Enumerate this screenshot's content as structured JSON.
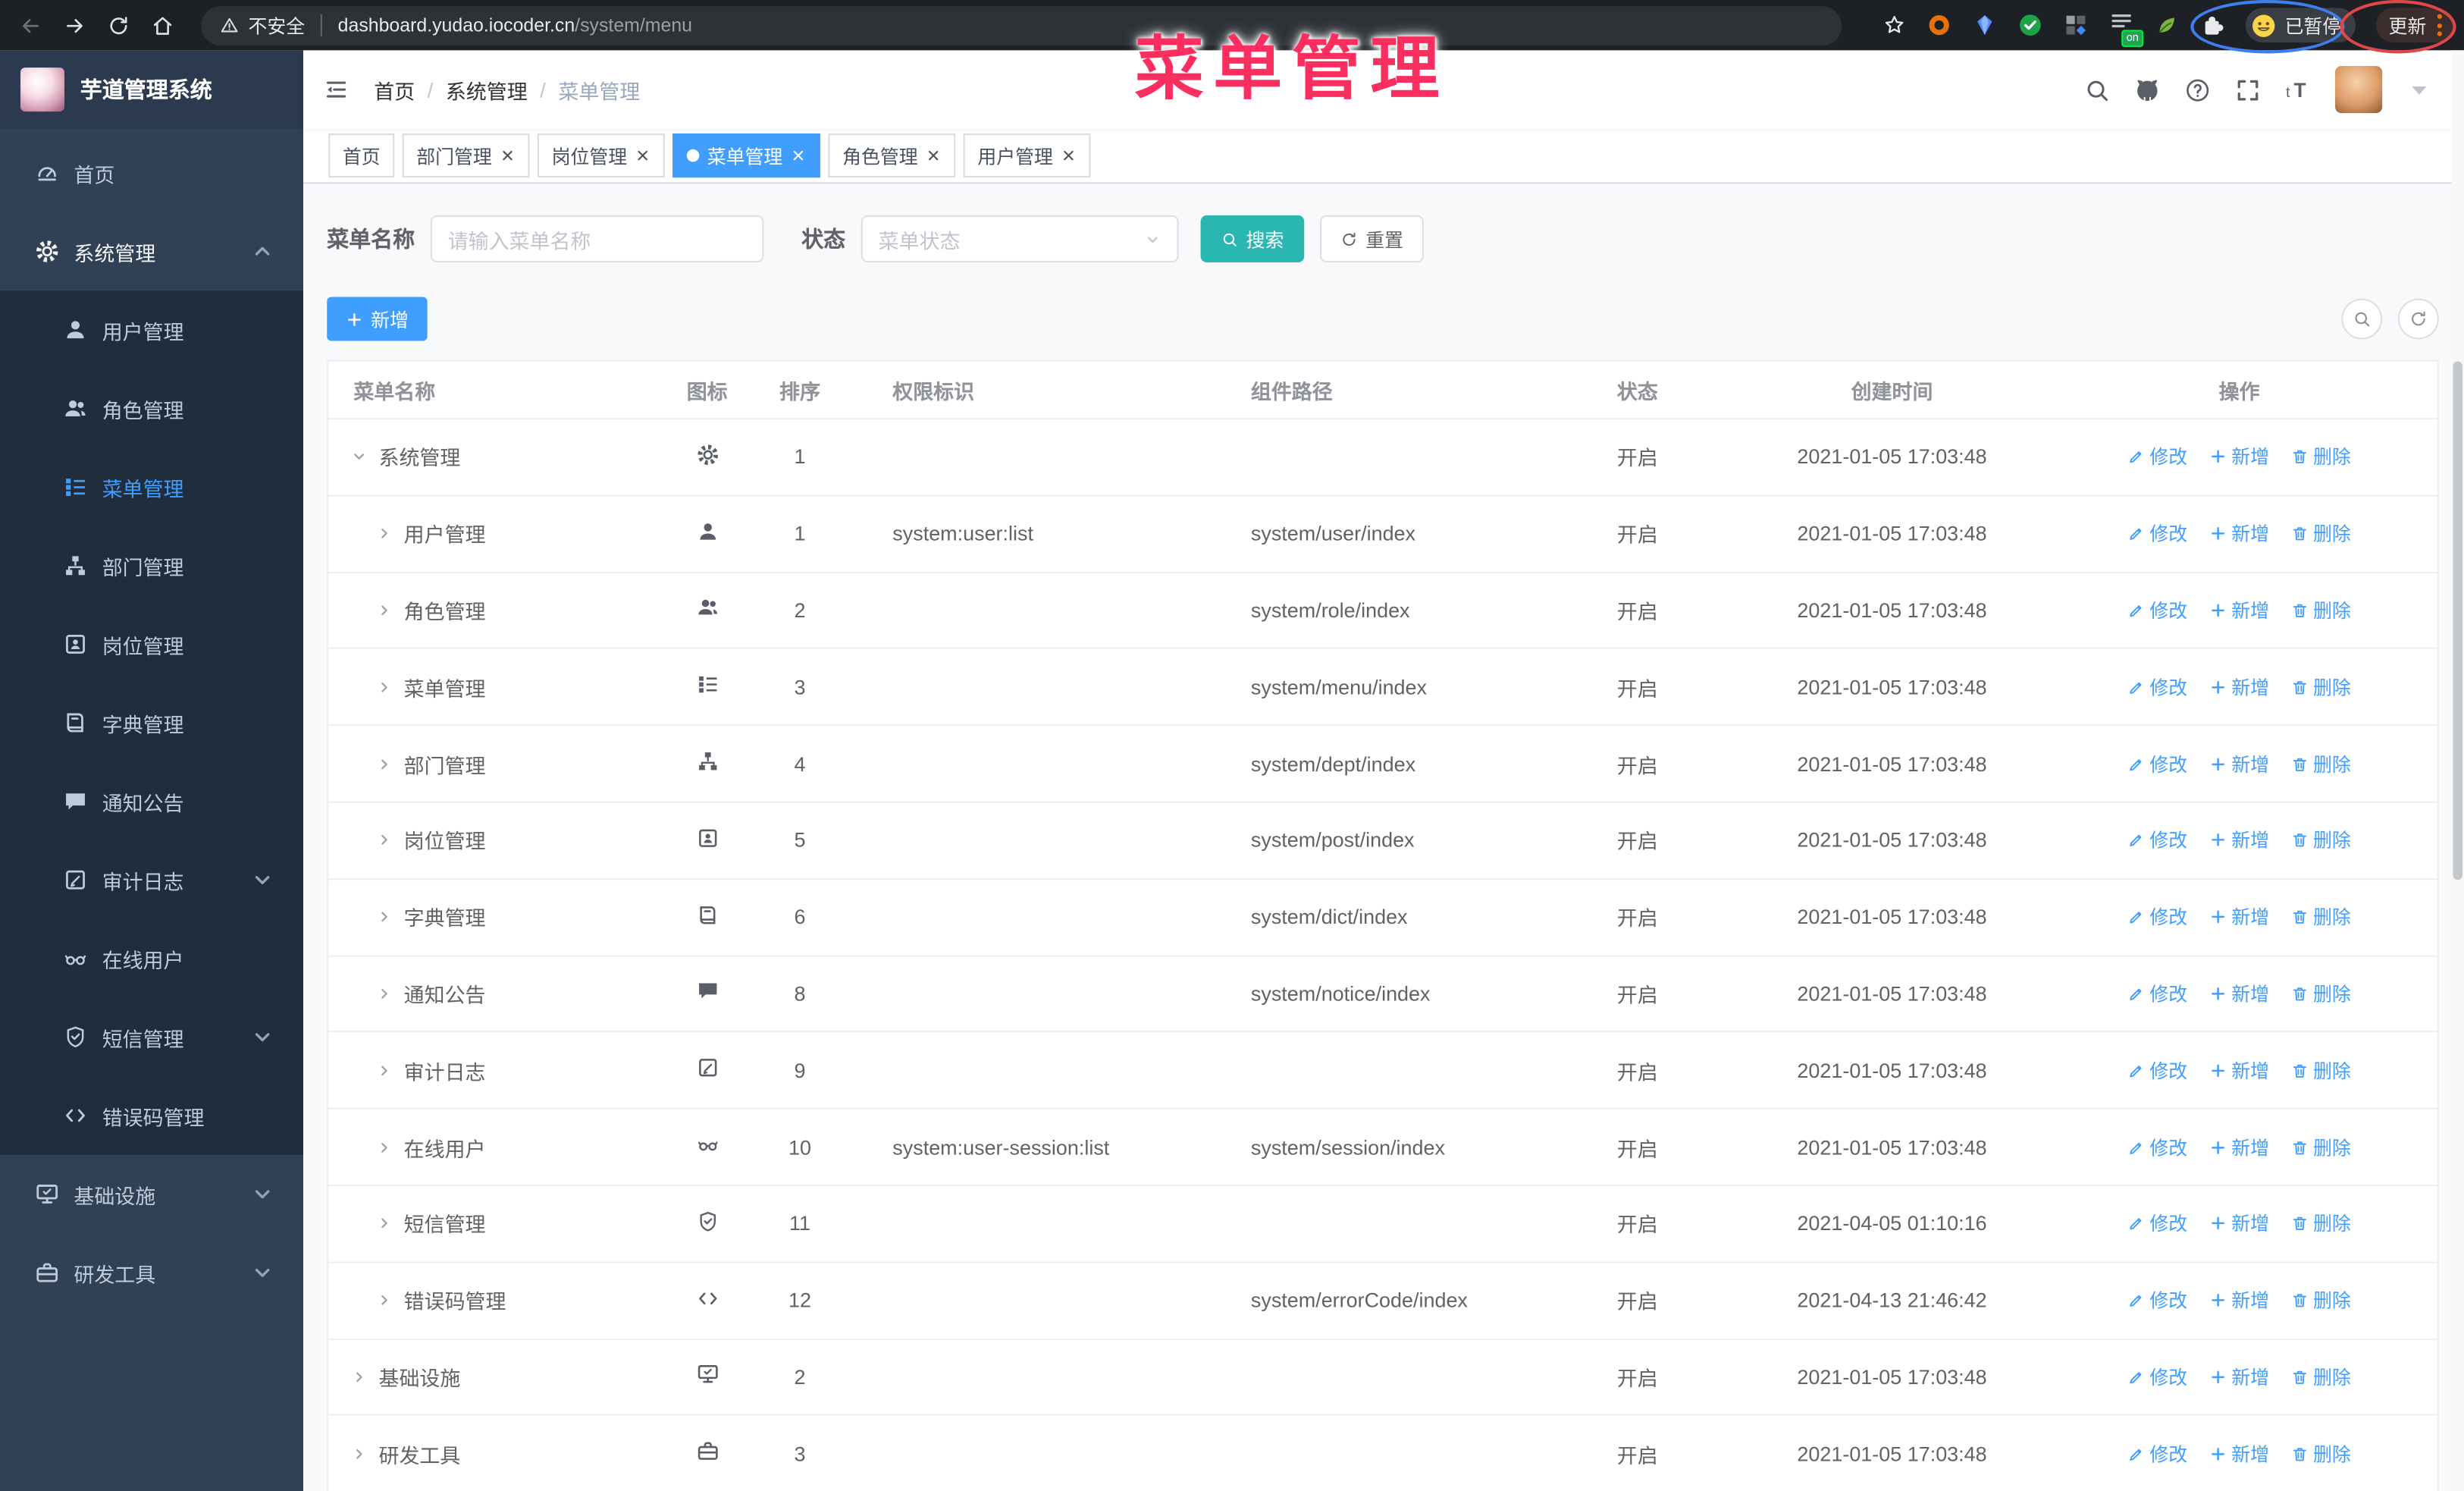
{
  "browser": {
    "security_label": "不安全",
    "url_host": "dashboard.yudao.iocoder.cn",
    "url_path": "/system/menu",
    "paused_badge": "已暂停",
    "update_button": "更新",
    "on_badge": "on"
  },
  "overlay_title": "菜单管理",
  "header": {
    "breadcrumb": [
      "首页",
      "系统管理",
      "菜单管理"
    ],
    "separator": "/"
  },
  "sidebar": {
    "app_title": "芋道管理系统",
    "items": [
      {
        "label": "首页",
        "icon": "dashboard-icon",
        "level": 1
      },
      {
        "label": "系统管理",
        "icon": "gear-icon",
        "level": 1,
        "expanded": true,
        "arrow": "up"
      },
      {
        "label": "用户管理",
        "icon": "user-icon",
        "level": 2
      },
      {
        "label": "角色管理",
        "icon": "peoples-icon",
        "level": 2
      },
      {
        "label": "菜单管理",
        "icon": "tree-table-icon",
        "level": 2,
        "active": true
      },
      {
        "label": "部门管理",
        "icon": "tree-icon",
        "level": 2
      },
      {
        "label": "岗位管理",
        "icon": "post-icon",
        "level": 2
      },
      {
        "label": "字典管理",
        "icon": "dict-icon",
        "level": 2
      },
      {
        "label": "通知公告",
        "icon": "message-icon",
        "level": 2
      },
      {
        "label": "审计日志",
        "icon": "log-icon",
        "level": 2,
        "arrow": "down"
      },
      {
        "label": "在线用户",
        "icon": "online-icon",
        "level": 2
      },
      {
        "label": "短信管理",
        "icon": "sms-icon",
        "level": 2,
        "arrow": "down"
      },
      {
        "label": "错误码管理",
        "icon": "code-icon",
        "level": 2
      },
      {
        "label": "基础设施",
        "icon": "monitor-icon",
        "level": 1,
        "arrow": "down"
      },
      {
        "label": "研发工具",
        "icon": "tool-icon",
        "level": 1,
        "arrow": "down"
      }
    ]
  },
  "tabs": [
    {
      "label": "首页",
      "closable": false,
      "active": false
    },
    {
      "label": "部门管理",
      "closable": true,
      "active": false
    },
    {
      "label": "岗位管理",
      "closable": true,
      "active": false
    },
    {
      "label": "菜单管理",
      "closable": true,
      "active": true
    },
    {
      "label": "角色管理",
      "closable": true,
      "active": false
    },
    {
      "label": "用户管理",
      "closable": true,
      "active": false
    }
  ],
  "filters": {
    "name_label": "菜单名称",
    "name_placeholder": "请输入菜单名称",
    "status_label": "状态",
    "status_placeholder": "菜单状态",
    "search_label": "搜索",
    "reset_label": "重置"
  },
  "toolbar": {
    "add_label": "新增"
  },
  "table": {
    "columns": [
      "菜单名称",
      "图标",
      "排序",
      "权限标识",
      "组件路径",
      "状态",
      "创建时间",
      "操作"
    ],
    "actions": {
      "edit": "修改",
      "add": "新增",
      "delete": "删除"
    },
    "rows": [
      {
        "name": "系统管理",
        "icon": "gear-icon",
        "level": 1,
        "expanded": true,
        "sort": "1",
        "perm": "",
        "path": "",
        "status": "开启",
        "time": "2021-01-05 17:03:48"
      },
      {
        "name": "用户管理",
        "icon": "user-icon",
        "level": 2,
        "expanded": false,
        "sort": "1",
        "perm": "system:user:list",
        "path": "system/user/index",
        "status": "开启",
        "time": "2021-01-05 17:03:48"
      },
      {
        "name": "角色管理",
        "icon": "peoples-icon",
        "level": 2,
        "expanded": false,
        "sort": "2",
        "perm": "",
        "path": "system/role/index",
        "status": "开启",
        "time": "2021-01-05 17:03:48"
      },
      {
        "name": "菜单管理",
        "icon": "tree-table-icon",
        "level": 2,
        "expanded": false,
        "sort": "3",
        "perm": "",
        "path": "system/menu/index",
        "status": "开启",
        "time": "2021-01-05 17:03:48"
      },
      {
        "name": "部门管理",
        "icon": "tree-icon",
        "level": 2,
        "expanded": false,
        "sort": "4",
        "perm": "",
        "path": "system/dept/index",
        "status": "开启",
        "time": "2021-01-05 17:03:48"
      },
      {
        "name": "岗位管理",
        "icon": "post-icon",
        "level": 2,
        "expanded": false,
        "sort": "5",
        "perm": "",
        "path": "system/post/index",
        "status": "开启",
        "time": "2021-01-05 17:03:48"
      },
      {
        "name": "字典管理",
        "icon": "dict-icon",
        "level": 2,
        "expanded": false,
        "sort": "6",
        "perm": "",
        "path": "system/dict/index",
        "status": "开启",
        "time": "2021-01-05 17:03:48"
      },
      {
        "name": "通知公告",
        "icon": "message-icon",
        "level": 2,
        "expanded": false,
        "sort": "8",
        "perm": "",
        "path": "system/notice/index",
        "status": "开启",
        "time": "2021-01-05 17:03:48"
      },
      {
        "name": "审计日志",
        "icon": "log-icon",
        "level": 2,
        "expanded": false,
        "sort": "9",
        "perm": "",
        "path": "",
        "status": "开启",
        "time": "2021-01-05 17:03:48"
      },
      {
        "name": "在线用户",
        "icon": "online-icon",
        "level": 2,
        "expanded": false,
        "sort": "10",
        "perm": "system:user-session:list",
        "path": "system/session/index",
        "status": "开启",
        "time": "2021-01-05 17:03:48"
      },
      {
        "name": "短信管理",
        "icon": "sms-icon",
        "level": 2,
        "expanded": false,
        "sort": "11",
        "perm": "",
        "path": "",
        "status": "开启",
        "time": "2021-04-05 01:10:16"
      },
      {
        "name": "错误码管理",
        "icon": "code-icon",
        "level": 2,
        "expanded": false,
        "sort": "12",
        "perm": "",
        "path": "system/errorCode/index",
        "status": "开启",
        "time": "2021-04-13 21:46:42"
      },
      {
        "name": "基础设施",
        "icon": "monitor-icon",
        "level": 1,
        "expanded": false,
        "sort": "2",
        "perm": "",
        "path": "",
        "status": "开启",
        "time": "2021-01-05 17:03:48"
      },
      {
        "name": "研发工具",
        "icon": "tool-icon",
        "level": 1,
        "expanded": false,
        "sort": "3",
        "perm": "",
        "path": "",
        "status": "开启",
        "time": "2021-01-05 17:03:48"
      }
    ]
  },
  "colors": {
    "accent": "#409eff",
    "search_button": "#2bb7b1",
    "overlay_title": "#fb2f5f",
    "sidebar_bg": "#304156",
    "submenu_bg": "#1f2d3d"
  }
}
